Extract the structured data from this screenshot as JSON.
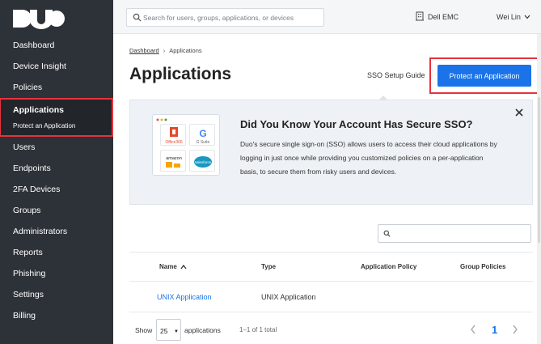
{
  "brand": {
    "logo_text": "DUO"
  },
  "sidebar": {
    "items_before": [
      {
        "label": "Dashboard"
      },
      {
        "label": "Device Insight"
      },
      {
        "label": "Policies"
      }
    ],
    "active": {
      "label": "Applications",
      "sub_label": "Protect an Application"
    },
    "items_after": [
      {
        "label": "Users"
      },
      {
        "label": "Endpoints"
      },
      {
        "label": "2FA Devices"
      },
      {
        "label": "Groups"
      },
      {
        "label": "Administrators"
      },
      {
        "label": "Reports"
      },
      {
        "label": "Phishing"
      },
      {
        "label": "Settings"
      },
      {
        "label": "Billing"
      }
    ]
  },
  "topbar": {
    "search_placeholder": "Search for users, groups, applications, or devices",
    "org_name": "Dell EMC",
    "user_name": "Wei Lin"
  },
  "breadcrumb": {
    "root": "Dashboard",
    "current": "Applications"
  },
  "page": {
    "title": "Applications",
    "sso_guide_label": "SSO Setup Guide",
    "protect_button_label": "Protect an Application"
  },
  "banner": {
    "title": "Did You Know Your Account Has Secure SSO?",
    "text": "Duo's secure single sign-on (SSO) allows users to access their cloud applications by logging in just once while providing you customized policies on a per-application basis, to secure them from risky users and devices.",
    "tiles": [
      "Office365",
      "G Suite",
      "amazon",
      "salesforce"
    ]
  },
  "table": {
    "columns": [
      "Name",
      "Type",
      "Application Policy",
      "Group Policies"
    ],
    "rows": [
      {
        "name": "UNIX Application",
        "type": "UNIX Application",
        "policy": "",
        "group_policies": ""
      }
    ]
  },
  "footer": {
    "show_label": "Show",
    "page_size": "25",
    "apps_label": "applications",
    "range": "1–1 of 1 total",
    "current_page": "1"
  },
  "colors": {
    "accent": "#1a73e8",
    "highlight": "#e8323c",
    "sidebar_bg": "#2d3238"
  }
}
